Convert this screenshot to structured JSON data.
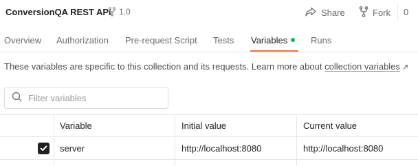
{
  "header": {
    "title": "ConversionQA REST API",
    "version": "1.0",
    "share_label": "Share",
    "fork_label": "Fork",
    "fork_count": "0"
  },
  "tabs": [
    {
      "label": "Overview",
      "active": false
    },
    {
      "label": "Authorization",
      "active": false
    },
    {
      "label": "Pre-request Script",
      "active": false
    },
    {
      "label": "Tests",
      "active": false
    },
    {
      "label": "Variables",
      "active": true,
      "indicator": "green-dot"
    },
    {
      "label": "Runs",
      "active": false
    }
  ],
  "description": {
    "text": "These variables are specific to this collection and its requests. Learn more about",
    "link_text": "collection variables",
    "link_icon": "arrow-up-right-icon"
  },
  "filter": {
    "placeholder": "Filter variables",
    "value": ""
  },
  "table": {
    "columns": [
      "Variable",
      "Initial value",
      "Current value"
    ],
    "rows": [
      {
        "checked": true,
        "variable": "server",
        "initial_value": "http://localhost:8080",
        "current_value": "http://localhost:8080"
      }
    ]
  },
  "colors": {
    "accent": "#ff6c37",
    "indicator": "#0cbb52",
    "text": "#212121",
    "muted": "#6b6b6b",
    "border": "#e6e6e6"
  }
}
